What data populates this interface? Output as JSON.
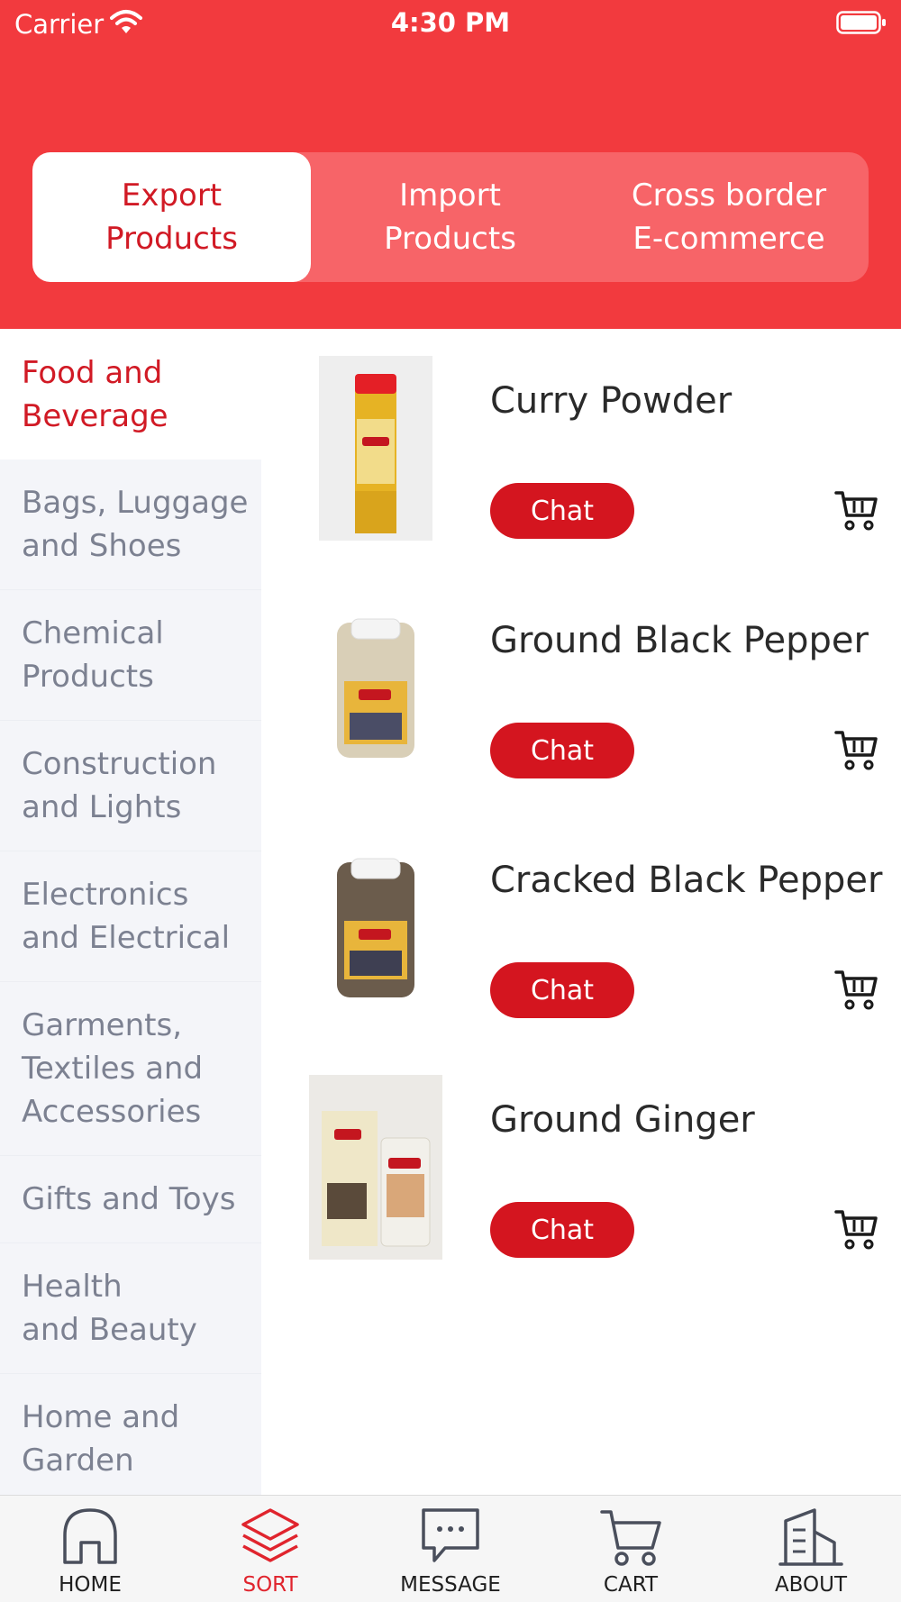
{
  "status_bar": {
    "carrier": "Carrier",
    "time": "4:30 PM"
  },
  "segments": [
    {
      "label": "Export\nProducts",
      "selected": true
    },
    {
      "label": "Import\nProducts",
      "selected": false
    },
    {
      "label": "Cross border\nE-commerce",
      "selected": false
    }
  ],
  "categories": [
    {
      "label": "Food and\nBeverage",
      "active": true
    },
    {
      "label": "Bags, Luggage\nand Shoes"
    },
    {
      "label": "Chemical\nProducts"
    },
    {
      "label": "Construction\nand Lights"
    },
    {
      "label": "Electronics\nand Electrical"
    },
    {
      "label": "Garments,\nTextiles and\nAccessories"
    },
    {
      "label": "Gifts and Toys"
    },
    {
      "label": "Health\nand Beauty"
    },
    {
      "label": "Home and\nGarden"
    }
  ],
  "products": [
    {
      "name": "Curry Powder",
      "chat_label": "Chat"
    },
    {
      "name": "Ground Black Pepper",
      "chat_label": "Chat"
    },
    {
      "name": "Cracked Black Pepper",
      "chat_label": "Chat"
    },
    {
      "name": "Ground Ginger",
      "chat_label": "Chat"
    }
  ],
  "tabbar": [
    {
      "label": "HOME",
      "icon": "home-icon"
    },
    {
      "label": "SORT",
      "icon": "layers-icon",
      "active": true
    },
    {
      "label": "MESSAGE",
      "icon": "message-icon"
    },
    {
      "label": "CART",
      "icon": "cart-icon"
    },
    {
      "label": "ABOUT",
      "icon": "building-icon"
    }
  ],
  "colors": {
    "brand_red": "#f23a3e",
    "accent_red": "#d4151f",
    "sidebar_bg": "#f4f5f9"
  }
}
